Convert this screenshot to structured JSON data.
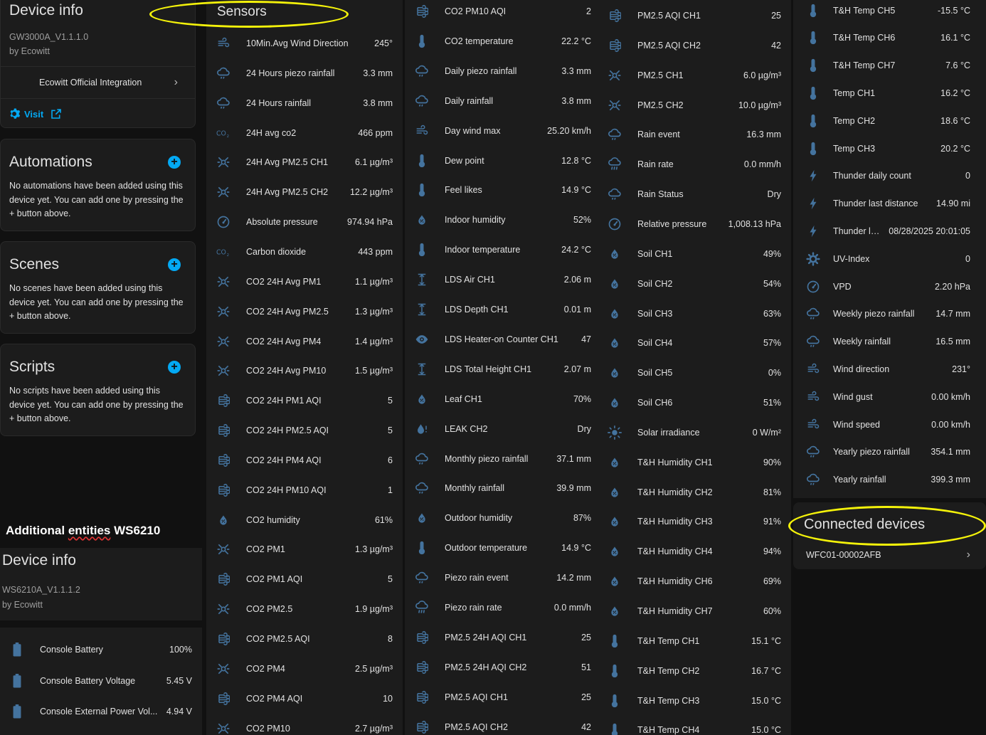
{
  "device1": {
    "title": "Device info",
    "model": "GW3000A_V1.1.1.0",
    "manufacturer": "by Ecowitt",
    "integration": "Ecowitt Official Integration",
    "visit": "Visit"
  },
  "automations": {
    "title": "Automations",
    "text": "No automations have been added using this device yet. You can add one by pressing the + button above."
  },
  "scenes": {
    "title": "Scenes",
    "text": "No scenes have been added using this device yet. You can add one by pressing the + button above."
  },
  "scripts": {
    "title": "Scripts",
    "text": "No scripts have been added using this device yet. You can add one by pressing the + button above."
  },
  "annotation": {
    "prefix": "Additional",
    "word": "entities",
    "suffix": "WS6210"
  },
  "device2": {
    "title": "Device info",
    "model": "WS6210A_V1.1.1.2",
    "manufacturer": "by Ecowitt",
    "entities": [
      {
        "icon": "battery-icon",
        "name": "Console Battery",
        "value": "100%"
      },
      {
        "icon": "battery-icon",
        "name": "Console Battery Voltage",
        "value": "5.45 V"
      },
      {
        "icon": "battery-icon",
        "name": "Console External Power Vol...",
        "value": "4.94 V"
      }
    ]
  },
  "sensors": {
    "title": "Sensors",
    "col1": [
      {
        "icon": "wind-icon",
        "name": "10Min.Avg Wind Direction",
        "value": "245°"
      },
      {
        "icon": "rain-icon",
        "name": "24 Hours piezo rainfall",
        "value": "3.3 mm"
      },
      {
        "icon": "rain-icon",
        "name": "24 Hours rainfall",
        "value": "3.8 mm"
      },
      {
        "icon": "co2-icon",
        "name": "24H avg co2",
        "value": "466 ppm"
      },
      {
        "icon": "particle-icon",
        "name": "24H Avg PM2.5 CH1",
        "value": "6.1 µg/m³"
      },
      {
        "icon": "particle-icon",
        "name": "24H Avg PM2.5 CH2",
        "value": "12.2 µg/m³"
      },
      {
        "icon": "gauge-icon",
        "name": "Absolute pressure",
        "value": "974.94 hPa"
      },
      {
        "icon": "co2-icon",
        "name": "Carbon dioxide",
        "value": "443 ppm"
      },
      {
        "icon": "particle-icon",
        "name": "CO2 24H Avg PM1",
        "value": "1.1 µg/m³"
      },
      {
        "icon": "particle-icon",
        "name": "CO2 24H Avg PM2.5",
        "value": "1.3 µg/m³"
      },
      {
        "icon": "particle-icon",
        "name": "CO2 24H Avg PM4",
        "value": "1.4 µg/m³"
      },
      {
        "icon": "particle-icon",
        "name": "CO2 24H Avg PM10",
        "value": "1.5 µg/m³"
      },
      {
        "icon": "aqi-icon",
        "name": "CO2 24H PM1 AQI",
        "value": "5"
      },
      {
        "icon": "aqi-icon",
        "name": "CO2 24H PM2.5 AQI",
        "value": "5"
      },
      {
        "icon": "aqi-icon",
        "name": "CO2 24H PM4 AQI",
        "value": "6"
      },
      {
        "icon": "aqi-icon",
        "name": "CO2 24H PM10 AQI",
        "value": "1"
      },
      {
        "icon": "humidity-icon",
        "name": "CO2 humidity",
        "value": "61%"
      },
      {
        "icon": "particle-icon",
        "name": "CO2 PM1",
        "value": "1.3 µg/m³"
      },
      {
        "icon": "aqi-icon",
        "name": "CO2 PM1 AQI",
        "value": "5"
      },
      {
        "icon": "particle-icon",
        "name": "CO2 PM2.5",
        "value": "1.9 µg/m³"
      },
      {
        "icon": "aqi-icon",
        "name": "CO2 PM2.5 AQI",
        "value": "8"
      },
      {
        "icon": "particle-icon",
        "name": "CO2 PM4",
        "value": "2.5 µg/m³"
      },
      {
        "icon": "aqi-icon",
        "name": "CO2 PM4 AQI",
        "value": "10"
      },
      {
        "icon": "particle-icon",
        "name": "CO2 PM10",
        "value": "2.7 µg/m³"
      }
    ],
    "col2": [
      {
        "icon": "aqi-icon",
        "name": "CO2 PM10 AQI",
        "value": "2"
      },
      {
        "icon": "thermometer-icon",
        "name": "CO2 temperature",
        "value": "22.2 °C"
      },
      {
        "icon": "rain-icon",
        "name": "Daily piezo rainfall",
        "value": "3.3 mm"
      },
      {
        "icon": "rain-icon",
        "name": "Daily rainfall",
        "value": "3.8 mm"
      },
      {
        "icon": "wind-icon",
        "name": "Day wind max",
        "value": "25.20 km/h"
      },
      {
        "icon": "thermometer-icon",
        "name": "Dew point",
        "value": "12.8 °C"
      },
      {
        "icon": "thermometer-icon",
        "name": "Feel likes",
        "value": "14.9 °C"
      },
      {
        "icon": "humidity-icon",
        "name": "Indoor humidity",
        "value": "52%"
      },
      {
        "icon": "thermometer-icon",
        "name": "Indoor temperature",
        "value": "24.2 °C"
      },
      {
        "icon": "height-icon",
        "name": "LDS Air CH1",
        "value": "2.06 m"
      },
      {
        "icon": "height-icon",
        "name": "LDS Depth CH1",
        "value": "0.01 m"
      },
      {
        "icon": "eye-icon",
        "name": "LDS Heater-on Counter CH1",
        "value": "47"
      },
      {
        "icon": "height-icon",
        "name": "LDS Total Height CH1",
        "value": "2.07 m"
      },
      {
        "icon": "humidity-icon",
        "name": "Leaf CH1",
        "value": "70%"
      },
      {
        "icon": "leak-icon",
        "name": "LEAK CH2",
        "value": "Dry"
      },
      {
        "icon": "rain-icon",
        "name": "Monthly piezo rainfall",
        "value": "37.1 mm"
      },
      {
        "icon": "rain-icon",
        "name": "Monthly rainfall",
        "value": "39.9 mm"
      },
      {
        "icon": "humidity-icon",
        "name": "Outdoor humidity",
        "value": "87%"
      },
      {
        "icon": "thermometer-icon",
        "name": "Outdoor temperature",
        "value": "14.9 °C"
      },
      {
        "icon": "rain-icon",
        "name": "Piezo rain event",
        "value": "14.2 mm"
      },
      {
        "icon": "pouring-icon",
        "name": "Piezo rain rate",
        "value": "0.0 mm/h"
      },
      {
        "icon": "aqi-icon",
        "name": "PM2.5 24H AQI CH1",
        "value": "25"
      },
      {
        "icon": "aqi-icon",
        "name": "PM2.5 24H AQI CH2",
        "value": "51"
      },
      {
        "icon": "aqi-icon",
        "name": "PM2.5 AQI CH1",
        "value": "25"
      },
      {
        "icon": "aqi-icon",
        "name": "PM2.5 AQI CH2",
        "value": "42"
      }
    ],
    "col3": [
      {
        "icon": "aqi-icon",
        "name": "PM2.5 AQI CH1",
        "value": "25"
      },
      {
        "icon": "aqi-icon",
        "name": "PM2.5 AQI CH2",
        "value": "42"
      },
      {
        "icon": "particle-icon",
        "name": "PM2.5 CH1",
        "value": "6.0 µg/m³"
      },
      {
        "icon": "particle-icon",
        "name": "PM2.5 CH2",
        "value": "10.0 µg/m³"
      },
      {
        "icon": "rain-icon",
        "name": "Rain event",
        "value": "16.3 mm"
      },
      {
        "icon": "pouring-icon",
        "name": "Rain rate",
        "value": "0.0 mm/h"
      },
      {
        "icon": "rain-icon",
        "name": "Rain Status",
        "value": "Dry"
      },
      {
        "icon": "gauge-icon",
        "name": "Relative pressure",
        "value": "1,008.13 hPa"
      },
      {
        "icon": "humidity-icon",
        "name": "Soil CH1",
        "value": "49%"
      },
      {
        "icon": "humidity-icon",
        "name": "Soil CH2",
        "value": "54%"
      },
      {
        "icon": "humidity-icon",
        "name": "Soil CH3",
        "value": "63%"
      },
      {
        "icon": "humidity-icon",
        "name": "Soil CH4",
        "value": "57%"
      },
      {
        "icon": "humidity-icon",
        "name": "Soil CH5",
        "value": "0%"
      },
      {
        "icon": "humidity-icon",
        "name": "Soil CH6",
        "value": "51%"
      },
      {
        "icon": "sun-icon",
        "name": "Solar irradiance",
        "value": "0 W/m²"
      },
      {
        "icon": "humidity-icon",
        "name": "T&H Humidity CH1",
        "value": "90%"
      },
      {
        "icon": "humidity-icon",
        "name": "T&H Humidity CH2",
        "value": "81%"
      },
      {
        "icon": "humidity-icon",
        "name": "T&H Humidity CH3",
        "value": "91%"
      },
      {
        "icon": "humidity-icon",
        "name": "T&H Humidity CH4",
        "value": "94%"
      },
      {
        "icon": "humidity-icon",
        "name": "T&H Humidity CH6",
        "value": "69%"
      },
      {
        "icon": "humidity-icon",
        "name": "T&H Humidity CH7",
        "value": "60%"
      },
      {
        "icon": "thermometer-icon",
        "name": "T&H Temp CH1",
        "value": "15.1 °C"
      },
      {
        "icon": "thermometer-icon",
        "name": "T&H Temp CH2",
        "value": "16.7 °C"
      },
      {
        "icon": "thermometer-icon",
        "name": "T&H Temp CH3",
        "value": "15.0 °C"
      },
      {
        "icon": "thermometer-icon",
        "name": "T&H Temp CH4",
        "value": "15.0 °C"
      }
    ],
    "col4": [
      {
        "icon": "thermometer-icon",
        "name": "T&H Temp CH5",
        "value": "-15.5 °C"
      },
      {
        "icon": "thermometer-icon",
        "name": "T&H Temp CH6",
        "value": "16.1 °C"
      },
      {
        "icon": "thermometer-icon",
        "name": "T&H Temp CH7",
        "value": "7.6 °C"
      },
      {
        "icon": "thermometer-icon",
        "name": "Temp CH1",
        "value": "16.2 °C"
      },
      {
        "icon": "thermometer-icon",
        "name": "Temp CH2",
        "value": "18.6 °C"
      },
      {
        "icon": "thermometer-icon",
        "name": "Temp CH3",
        "value": "20.2 °C"
      },
      {
        "icon": "lightning-icon",
        "name": "Thunder daily count",
        "value": "0"
      },
      {
        "icon": "lightning-icon",
        "name": "Thunder last distance",
        "value": "14.90 mi"
      },
      {
        "icon": "lightning-icon",
        "name": "Thunder last ...",
        "value": "08/28/2025 20:01:05"
      },
      {
        "icon": "uv-icon",
        "name": "UV-Index",
        "value": "0"
      },
      {
        "icon": "gauge-icon",
        "name": "VPD",
        "value": "2.20 hPa"
      },
      {
        "icon": "rain-icon",
        "name": "Weekly piezo rainfall",
        "value": "14.7 mm"
      },
      {
        "icon": "rain-icon",
        "name": "Weekly rainfall",
        "value": "16.5 mm"
      },
      {
        "icon": "wind-icon",
        "name": "Wind direction",
        "value": "231°"
      },
      {
        "icon": "wind-icon",
        "name": "Wind gust",
        "value": "0.00 km/h"
      },
      {
        "icon": "wind-icon",
        "name": "Wind speed",
        "value": "0.00 km/h"
      },
      {
        "icon": "rain-icon",
        "name": "Yearly piezo rainfall",
        "value": "354.1 mm"
      },
      {
        "icon": "rain-icon",
        "name": "Yearly rainfall",
        "value": "399.3 mm"
      }
    ]
  },
  "connected": {
    "title": "Connected devices",
    "device": "WFC01-00002AFB"
  },
  "colors": {
    "accent": "#03a9f4",
    "icon": "#44739e",
    "highlight": "#f4f20a",
    "card": "#1c1c1c",
    "background": "#111111"
  }
}
